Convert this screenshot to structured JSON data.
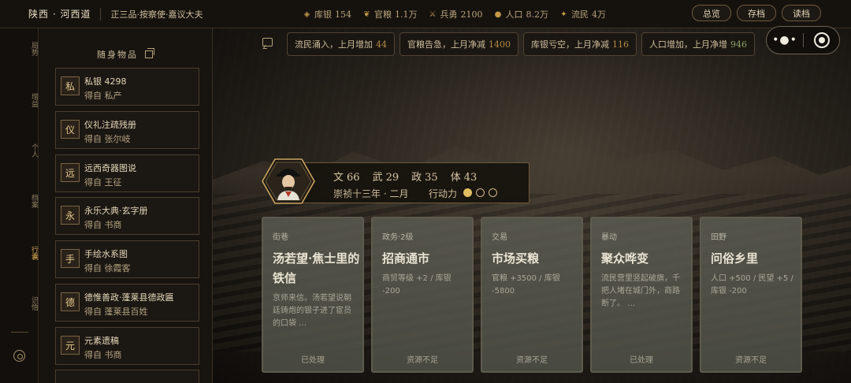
{
  "top": {
    "region": "陕西 · 河西道",
    "rank": "正三品·按察使·嘉议大夫",
    "stats": [
      {
        "icon": "silver-icon",
        "label": "库银",
        "value": "154"
      },
      {
        "icon": "grain-icon",
        "label": "官粮",
        "value": "1.1万"
      },
      {
        "icon": "soldier-icon",
        "label": "兵勇",
        "value": "2100"
      },
      {
        "icon": "population-icon",
        "label": "人口",
        "value": "8.2万"
      },
      {
        "icon": "refugee-icon",
        "label": "流民",
        "value": "4万"
      }
    ],
    "buttons": [
      "总览",
      "存档",
      "读档"
    ]
  },
  "nav": [
    {
      "label": "局势",
      "active": false
    },
    {
      "label": "增益",
      "active": false
    },
    {
      "label": "个人",
      "active": false
    },
    {
      "label": "档案",
      "active": false
    },
    {
      "label": "行囊",
      "active": true
    },
    {
      "label": "识悟",
      "active": false
    }
  ],
  "inventory": {
    "title": "随身物品",
    "items": [
      {
        "badge": "私",
        "name": "私银 4298",
        "source": "得自 私产"
      },
      {
        "badge": "仪",
        "name": "仪礼注疏残册",
        "source": "得自 张尔岐"
      },
      {
        "badge": "远",
        "name": "远西奇器图说",
        "source": "得自 王征"
      },
      {
        "badge": "永",
        "name": "永乐大典·玄字册",
        "source": "得自 书商"
      },
      {
        "badge": "手",
        "name": "手绘水系图",
        "source": "得自 徐霞客"
      },
      {
        "badge": "德",
        "name": "德惟善政·蓬莱县德政匾",
        "source": "得自 蓬莱县百姓"
      },
      {
        "badge": "元",
        "name": "元素遗稿",
        "source": "得自 书商"
      }
    ]
  },
  "events": [
    {
      "text": "流民涌入，上月增加",
      "value": "44",
      "trend": "down"
    },
    {
      "text": "官粮告急，上月净减",
      "value": "1400",
      "trend": "down"
    },
    {
      "text": "库银亏空，上月净减",
      "value": "116",
      "trend": "down"
    },
    {
      "text": "人口增加，上月净增",
      "value": "946",
      "trend": "up"
    }
  ],
  "character": {
    "attrs": [
      {
        "label": "文",
        "value": "66"
      },
      {
        "label": "武",
        "value": "29"
      },
      {
        "label": "政",
        "value": "35"
      },
      {
        "label": "体",
        "value": "43"
      }
    ],
    "date": "崇祯十三年 · 二月",
    "action_label": "行动力",
    "action_points": {
      "current": 1,
      "max": 3
    }
  },
  "cards": [
    {
      "tag": "街巷",
      "title": "汤若望·焦士里的铁信",
      "desc": "京师来信。汤若望说朝廷铸炮的银子进了宦员的口袋 …",
      "status": "已处理"
    },
    {
      "tag": "政务·2级",
      "title": "招商通市",
      "desc": "商贸等级 +2 / 库银 -200",
      "status": "资源不足"
    },
    {
      "tag": "交易",
      "title": "市场买粮",
      "desc": "官粮 +3500 / 库银 -5800",
      "status": "资源不足"
    },
    {
      "tag": "暴动",
      "title": "聚众哗变",
      "desc": "流民营里竖起破旗，千把人堵在城门外，商路断了。 …",
      "status": "已处理"
    },
    {
      "tag": "田野",
      "title": "问俗乡里",
      "desc": "人口 +500 / 民望 +5 / 库银 -200",
      "status": "资源不足"
    }
  ],
  "colors": {
    "accent": "#d6a854",
    "panel": "#17130f",
    "card": "#5c5c52"
  }
}
